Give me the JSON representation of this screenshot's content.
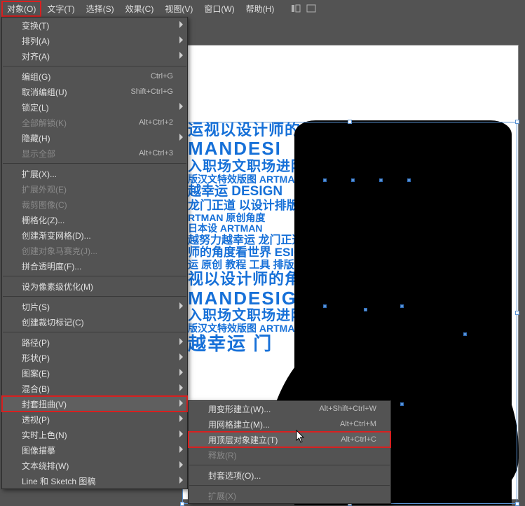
{
  "menubar": {
    "items": [
      "对象(O)",
      "文字(T)",
      "选择(S)",
      "效果(C)",
      "视图(V)",
      "窗口(W)",
      "帮助(H)"
    ]
  },
  "menu": {
    "items": [
      {
        "label": "变换(T)",
        "sub": true
      },
      {
        "label": "排列(A)",
        "sub": true
      },
      {
        "label": "对齐(A)",
        "sub": true
      },
      {
        "sep": true
      },
      {
        "label": "编组(G)",
        "shortcut": "Ctrl+G"
      },
      {
        "label": "取消编组(U)",
        "shortcut": "Shift+Ctrl+G"
      },
      {
        "label": "锁定(L)",
        "sub": true
      },
      {
        "label": "全部解锁(K)",
        "shortcut": "Alt+Ctrl+2",
        "disabled": true
      },
      {
        "label": "隐藏(H)",
        "sub": true
      },
      {
        "label": "显示全部",
        "shortcut": "Alt+Ctrl+3",
        "disabled": true
      },
      {
        "sep": true
      },
      {
        "label": "扩展(X)..."
      },
      {
        "label": "扩展外观(E)",
        "disabled": true
      },
      {
        "label": "裁剪图像(C)",
        "disabled": true
      },
      {
        "label": "栅格化(Z)..."
      },
      {
        "label": "创建渐变网格(D)..."
      },
      {
        "label": "创建对象马赛克(J)...",
        "disabled": true
      },
      {
        "label": "拼合透明度(F)..."
      },
      {
        "sep": true
      },
      {
        "label": "设为像素级优化(M)"
      },
      {
        "sep": true
      },
      {
        "label": "切片(S)",
        "sub": true
      },
      {
        "label": "创建裁切标记(C)"
      },
      {
        "sep": true
      },
      {
        "label": "路径(P)",
        "sub": true
      },
      {
        "label": "形状(P)",
        "sub": true
      },
      {
        "label": "图案(E)",
        "sub": true
      },
      {
        "label": "混合(B)",
        "sub": true
      },
      {
        "label": "封套扭曲(V)",
        "sub": true,
        "highlight": true
      },
      {
        "label": "透视(P)",
        "sub": true
      },
      {
        "label": "实时上色(N)",
        "sub": true
      },
      {
        "label": "图像描摹",
        "sub": true
      },
      {
        "label": "文本绕排(W)",
        "sub": true
      },
      {
        "label": "Line 和 Sketch 图稿",
        "sub": true
      }
    ]
  },
  "submenu": {
    "items": [
      {
        "label": "用变形建立(W)...",
        "shortcut": "Alt+Shift+Ctrl+W"
      },
      {
        "label": "用网格建立(M)...",
        "shortcut": "Alt+Ctrl+M"
      },
      {
        "label": "用顶层对象建立(T)",
        "shortcut": "Alt+Ctrl+C",
        "highlight": true
      },
      {
        "label": "释放(R)",
        "disabled": true
      },
      {
        "sep": true
      },
      {
        "label": "封套选项(O)..."
      },
      {
        "sep": true
      },
      {
        "label": "扩展(X)",
        "disabled": true
      }
    ]
  },
  "bgtext": {
    "r1": "运视以设计师的角",
    "r2": "MANDESI",
    "r3": "入职场文职场进阶立",
    "r4": "版汉文特效版图 ARTMAN",
    "r5": "越幸运 DESIGN",
    "r6": "龙门正道 以设计排版",
    "r7": "RTMAN 原创角度",
    "r8": "日本设 ARTMAN",
    "r9": "越努力越幸运 龙门正道",
    "r10": "师的角度看世界 ESIGN",
    "r11": "运 原创 教程 工具 排版 文",
    "r12": "视以设计师的角",
    "r13": "MANDESIG",
    "r14": "入职场文职场进阶 庞",
    "r15": "版汉文特效版图 ARTMAN",
    "r16": "越幸运 门"
  }
}
